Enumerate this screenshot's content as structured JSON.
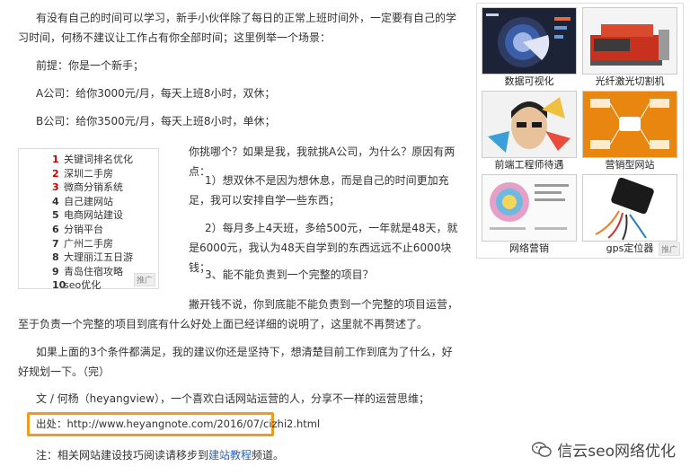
{
  "article": {
    "para1": "有没有自己的时间可以学习，新手小伙伴除了每日的正常上班时间外，一定要有自己的学习时间，何杨不建议让工作占有你全部时间；这里例举一个场景：",
    "premise": "前提：你是一个新手；",
    "company_a": "A公司：给你3000元/月，每天上班8小时，双休；",
    "company_b": "B公司：给你3500元/月，每天上班8小时，单休；",
    "question": "你挑哪个？如果是我，我就挑A公司，为什么？原因有两点：",
    "reason1": "1）想双休不是因为想休息，而是自己的时间更加充足，我可以安排自学一些东西；",
    "reason2": "2）每月多上4天班，多给500元，一年就是48天，就是6000元，我认为48天自学到的东西远远不止6000块钱；",
    "reason3": "3、能不能负责到一个完整的项目？",
    "para_project": "撇开钱不说，你到底能不能负责到一个完整的项目运营，至于负责一个完整的项目到底有什么好处上面已经详细的说明了，这里就不再赘述了。",
    "para_conclusion": "如果上面的3个条件都满足，我的建议你还是坚持下，想清楚目前工作到底为了什么，好好规划一下。（完）",
    "author": "文 / 何杨（heyangview），一个喜欢白话网站运营的人，分享不一样的运营思维；",
    "source": "出处：http://www.heyangnote.com/2016/07/cizhi2.html",
    "note_prefix": "注：相关网站建设技巧阅读请移步到",
    "note_link": "建站教程",
    "note_suffix": "频道。"
  },
  "keyword_ad": {
    "items": [
      {
        "num": "1",
        "label": "关键词排名优化"
      },
      {
        "num": "2",
        "label": "深圳二手房"
      },
      {
        "num": "3",
        "label": "微商分销系统"
      },
      {
        "num": "4",
        "label": "自己建网站"
      },
      {
        "num": "5",
        "label": "电商网站建设"
      },
      {
        "num": "6",
        "label": "分销平台"
      },
      {
        "num": "7",
        "label": "广州二手房"
      },
      {
        "num": "8",
        "label": "大理丽江五日游"
      },
      {
        "num": "9",
        "label": "青岛住宿攻略"
      },
      {
        "num": "10",
        "label": "seo优化"
      }
    ],
    "badge": "推广"
  },
  "image_ad": {
    "captions": [
      "数据可视化",
      "光纤激光切割机",
      "前端工程师待遇",
      "营销型网站",
      "网络营销",
      "gps定位器"
    ],
    "badge": "推广"
  },
  "watermark": "信云seo网络优化",
  "colors": {
    "highlight": "#f39a1d",
    "link": "#2a64b8",
    "rank_top": "#cc0000"
  }
}
